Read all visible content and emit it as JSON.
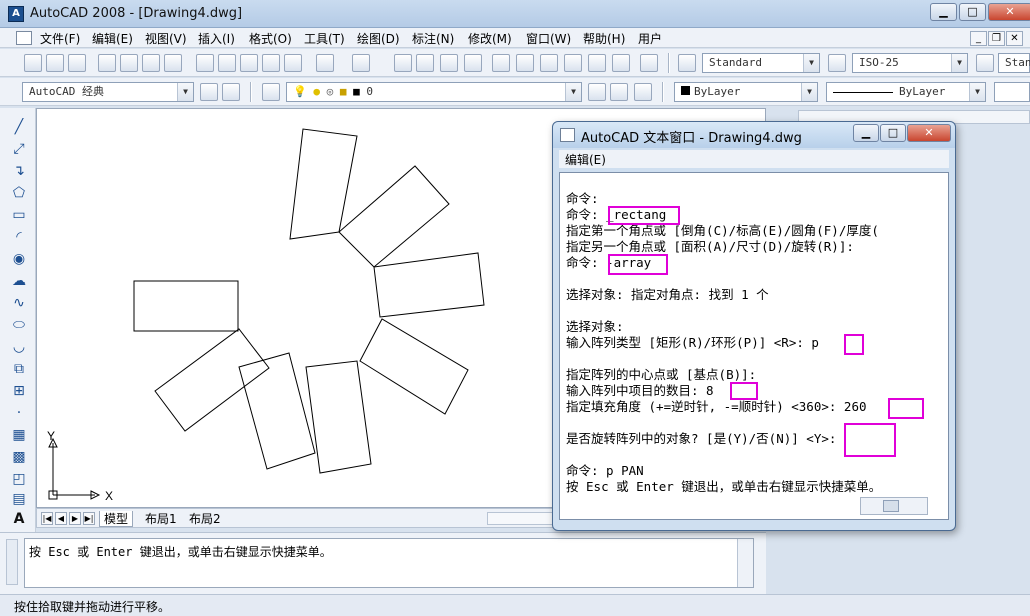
{
  "window": {
    "title": "AutoCAD 2008 - [Drawing4.dwg]",
    "min": "▁",
    "max": "□",
    "close": "✕"
  },
  "menubar": {
    "items": [
      "文件(F)",
      "编辑(E)",
      "视图(V)",
      "插入(I)",
      "格式(O)",
      "工具(T)",
      "绘图(D)",
      "标注(N)",
      "修改(M)",
      "窗口(W)",
      "帮助(H)",
      "用户"
    ]
  },
  "toolbar": {
    "text_style": "Standard",
    "dim_style": "ISO-25",
    "table_style_partial": "Stan",
    "workspace": "AutoCAD 经典",
    "layer": "0",
    "color": "ByLayer",
    "linetype": "ByLayer"
  },
  "draw_tools": [
    "line-icon",
    "construction-line-icon",
    "polyline-icon",
    "polygon-icon",
    "rectangle-icon",
    "arc-icon",
    "circle-icon",
    "revision-cloud-icon",
    "spline-icon",
    "ellipse-icon",
    "ellipse-arc-icon",
    "insert-block-icon",
    "make-block-icon",
    "point-icon",
    "hatch-icon",
    "gradient-icon",
    "region-icon",
    "table-icon",
    "multiline-text-icon"
  ],
  "ucs": {
    "x_label": "X",
    "y_label": "Y"
  },
  "layout_tabs": {
    "model": "模型",
    "layout1": "布局1",
    "layout2": "布局2"
  },
  "command_line": {
    "text": "按 Esc 或 Enter 键退出，或单击右键显示快捷菜单。"
  },
  "status": {
    "text": "按住拾取键并拖动进行平移。"
  },
  "text_window": {
    "title": "AutoCAD 文本窗口 - Drawing4.dwg",
    "menu_edit": "编辑(E)",
    "lines": [
      "命令:",
      "命令: _rectang",
      "指定第一个角点或 [倒角(C)/标高(E)/圆角(F)/厚度(",
      "指定另一个角点或 [面积(A)/尺寸(D)/旋转(R)]:",
      "命令: -array",
      "",
      "选择对象: 指定对角点: 找到 1 个",
      "",
      "选择对象:",
      "输入阵列类型 [矩形(R)/环形(P)] <R>: p",
      "",
      "指定阵列的中心点或 [基点(B)]:",
      "输入阵列中项目的数目: 8",
      "指定填充角度 (+=逆时针, -=顺时针) <360>: 260",
      "",
      "是否旋转阵列中的对象? [是(Y)/否(N)] <Y>:",
      "",
      "命令: p PAN",
      "按 Esc 或 Enter 键退出，或单击右键显示快捷菜单。"
    ]
  }
}
